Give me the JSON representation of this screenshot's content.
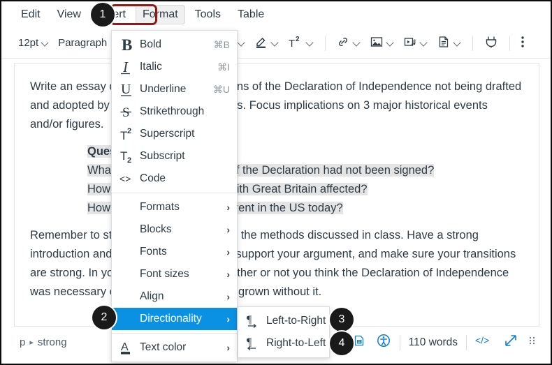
{
  "menubar": {
    "items": [
      {
        "label": "Edit",
        "active": false
      },
      {
        "label": "View",
        "active": false
      },
      {
        "label": "Insert",
        "active": false
      },
      {
        "label": "Format",
        "active": true
      },
      {
        "label": "Tools",
        "active": false
      },
      {
        "label": "Table",
        "active": false
      }
    ]
  },
  "toolbar": {
    "font_size": "12pt",
    "block_format": "Paragraph",
    "icons": [
      "highlight-color-icon",
      "superscript-icon",
      "link-icon",
      "image-icon",
      "media-icon",
      "document-icon",
      "plugin-icon",
      "kebab-more-icon"
    ]
  },
  "document": {
    "paragraph1": "Write an essay describing the ramifications of the Declaration of Independence not being drafted and adopted by the Continental Congress. Focus implications on 3 major historical events and/or figures.",
    "questions_title": "Questions to consider:",
    "questions": [
      "What would have happened if the Declaration had not been signed?",
      "How would the relationship with Great Britain affected?",
      "How would the world be different in the US today?"
    ],
    "paragraph2": "Remember to structure your essay using the methods discussed in class. Have a strong introduction and thesis, use evidence to support your argument, and make sure your transitions are strong. In your conclusion, state whether or not you think the Declaration of Independence was necessary or if America would have grown without it."
  },
  "statusbar": {
    "breadcrumb": [
      "p",
      "strong"
    ],
    "breadcrumb_separator": "▸",
    "word_count": "110 words",
    "icons": [
      "html-editor-icon",
      "accessibility-checker-icon",
      "code-view-icon",
      "fullscreen-icon",
      "resize-handle-icon"
    ]
  },
  "format_menu": {
    "items": [
      {
        "label": "Bold",
        "accel": "⌘B",
        "icon": "bold-icon",
        "type": "item"
      },
      {
        "label": "Italic",
        "accel": "⌘I",
        "icon": "italic-icon",
        "type": "item"
      },
      {
        "label": "Underline",
        "accel": "⌘U",
        "icon": "underline-icon",
        "type": "item"
      },
      {
        "label": "Strikethrough",
        "accel": "",
        "icon": "strikethrough-icon",
        "type": "item"
      },
      {
        "label": "Superscript",
        "accel": "",
        "icon": "superscript-icon",
        "type": "item"
      },
      {
        "label": "Subscript",
        "accel": "",
        "icon": "subscript-icon",
        "type": "item"
      },
      {
        "label": "Code",
        "accel": "",
        "icon": "code-icon",
        "type": "item"
      },
      {
        "type": "divider"
      },
      {
        "label": "Formats",
        "accel": "",
        "icon": "",
        "type": "submenu"
      },
      {
        "label": "Blocks",
        "accel": "",
        "icon": "",
        "type": "submenu"
      },
      {
        "label": "Fonts",
        "accel": "",
        "icon": "",
        "type": "submenu"
      },
      {
        "label": "Font sizes",
        "accel": "",
        "icon": "",
        "type": "submenu"
      },
      {
        "label": "Align",
        "accel": "",
        "icon": "",
        "type": "submenu"
      },
      {
        "label": "Directionality",
        "accel": "",
        "icon": "",
        "type": "submenu",
        "selected": true
      },
      {
        "type": "divider"
      },
      {
        "label": "Text color",
        "accel": "",
        "icon": "text-color-icon",
        "type": "submenu"
      }
    ],
    "arrow_glyph": "›",
    "highlight_color": "#0b91e4"
  },
  "directionality_submenu": {
    "items": [
      {
        "label": "Left-to-Right",
        "icon": "ltr-paragraph-icon"
      },
      {
        "label": "Right-to-Left",
        "icon": "rtl-paragraph-icon"
      }
    ]
  },
  "callouts": [
    {
      "id": "1",
      "label": "1"
    },
    {
      "id": "2",
      "label": "2"
    },
    {
      "id": "3",
      "label": "3"
    },
    {
      "id": "4",
      "label": "4"
    }
  ],
  "colors": {
    "accent_blue": "#0b91e4",
    "highlight_ring_red": "#8f1a1a",
    "text": "#2d3b45",
    "selection_gray": "#e4e4e4",
    "status_icon_blue": "#0b7fd4"
  }
}
